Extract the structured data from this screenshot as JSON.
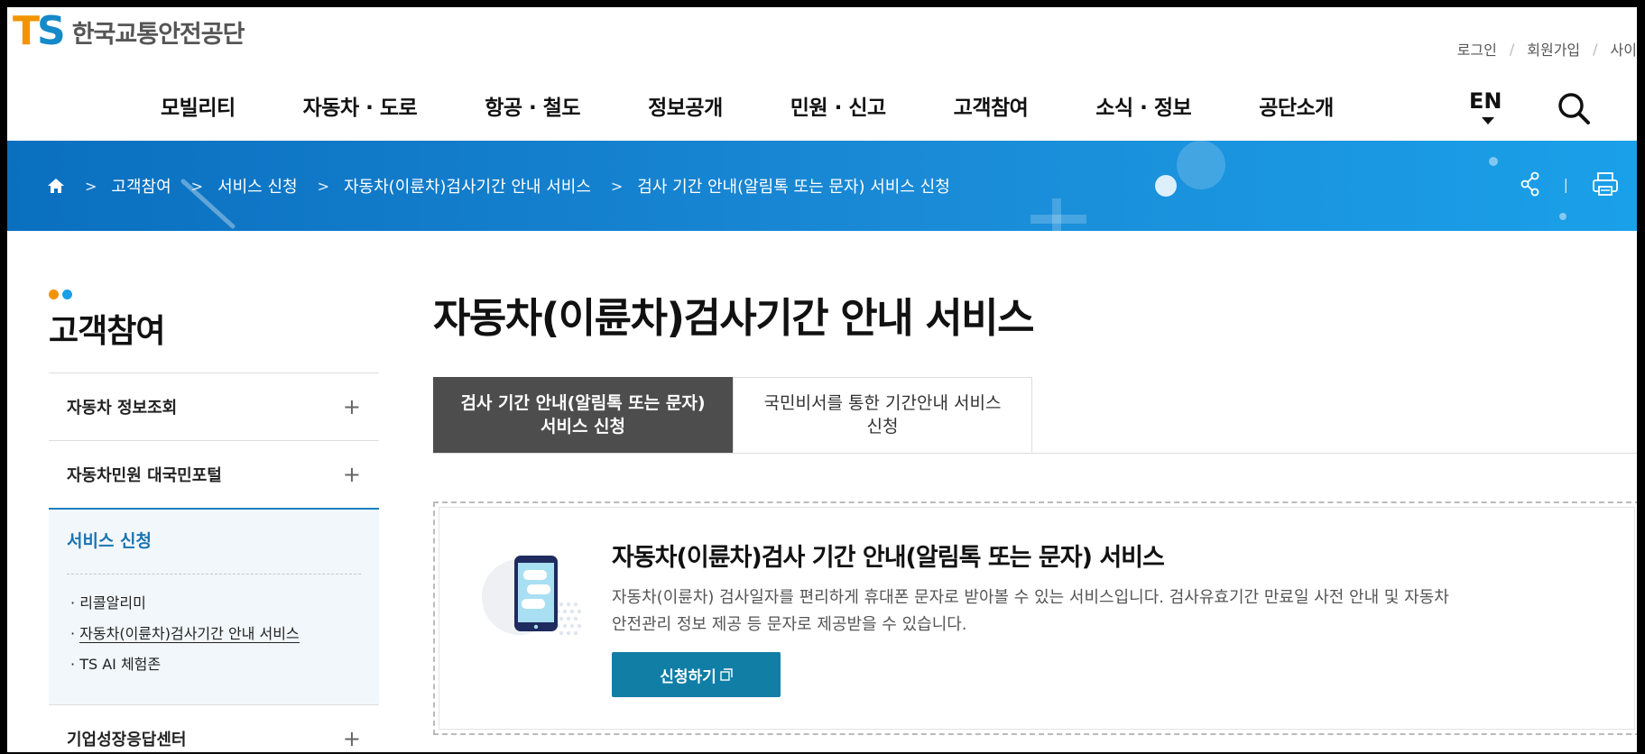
{
  "header": {
    "logo_mark_t": "T",
    "logo_mark_s": "S",
    "org_name": "한국교통안전공단",
    "util_links": [
      "로그인",
      "회원가입",
      "사이"
    ],
    "util_sep": "/",
    "gnb": [
      "모빌리티",
      "자동차 · 도로",
      "항공 · 철도",
      "정보공개",
      "민원 · 신고",
      "고객참여",
      "소식 · 정보",
      "공단소개"
    ],
    "lang": "EN"
  },
  "breadcrumb": {
    "items": [
      "고객참여",
      "서비스 신청",
      "자동차(이륜차)검사기간 안내 서비스",
      "검사 기간 안내(알림톡 또는 문자) 서비스 신청"
    ],
    "chev": ">",
    "tools_sep": "|"
  },
  "sidebar": {
    "title": "고객참여",
    "items": [
      {
        "label": "자동차 정보조회",
        "toggle": "+"
      },
      {
        "label": "자동차민원 대국민포털",
        "toggle": "+"
      }
    ],
    "active": {
      "label": "서비스 신청",
      "subs": [
        "리콜알리미",
        "자동차(이륜차)검사기간 안내 서비스",
        "TS AI 체험존"
      ],
      "bullet": "·"
    },
    "last_item": {
      "label": "기업성장응답센터",
      "toggle": "+"
    }
  },
  "content": {
    "title": "자동차(이륜차)검사기간 안내 서비스",
    "tabs": [
      {
        "line1": "검사 기간 안내(알림톡 또는 문자)",
        "line2": "서비스 신청"
      },
      {
        "line1": "국민비서를 통한 기간안내 서비스",
        "line2": "신청"
      }
    ],
    "service": {
      "title": "자동차(이륜차)검사 기간 안내(알림톡 또는 문자) 서비스",
      "desc_line1": "자동차(이륜차) 검사일자를 편리하게 휴대폰 문자로 받아볼 수 있는 서비스입니다. 검사유효기간 만료일 사전 안내 및 자동차",
      "desc_line2": "안전관리 정보 제공 등 문자로 제공받을 수 있습니다.",
      "button": "신청하기"
    }
  },
  "colors": {
    "brand_orange": "#f29400",
    "brand_blue": "#1689c9",
    "band_blue": "#1a8ad6",
    "tab_active": "#4d4d4d",
    "button": "#117ea6",
    "sidebar_active": "#1a74b0"
  },
  "icons": [
    "home-icon",
    "search-icon",
    "share-icon",
    "print-icon",
    "phone-chat-icon",
    "external-link-icon"
  ]
}
